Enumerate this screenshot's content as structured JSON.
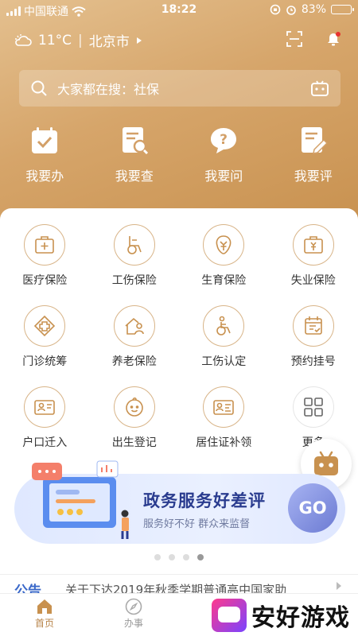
{
  "status_bar": {
    "carrier": "中国联通",
    "time": "18:22",
    "battery": "83%",
    "battery_level": 0.83
  },
  "header": {
    "temperature": "11°C",
    "city": "北京市"
  },
  "search": {
    "placeholder": "大家都在搜：社保"
  },
  "quick_actions": [
    {
      "label": "我要办",
      "icon": "calendar-check-icon"
    },
    {
      "label": "我要查",
      "icon": "document-search-icon"
    },
    {
      "label": "我要问",
      "icon": "question-bubble-icon"
    },
    {
      "label": "我要评",
      "icon": "document-edit-icon"
    }
  ],
  "services": [
    {
      "label": "医疗保险",
      "icon": "medical-kit-icon"
    },
    {
      "label": "工伤保险",
      "icon": "wheelchair-icon"
    },
    {
      "label": "生育保险",
      "icon": "maternity-icon"
    },
    {
      "label": "失业保险",
      "icon": "yuan-briefcase-icon"
    },
    {
      "label": "门诊统筹",
      "icon": "clinic-cross-icon"
    },
    {
      "label": "养老保险",
      "icon": "elder-home-icon"
    },
    {
      "label": "工伤认定",
      "icon": "injury-wheelchair-icon"
    },
    {
      "label": "预约挂号",
      "icon": "appointment-calendar-icon"
    },
    {
      "label": "户口迁入",
      "icon": "id-card-icon"
    },
    {
      "label": "出生登记",
      "icon": "baby-face-icon"
    },
    {
      "label": "居住证补领",
      "icon": "residence-card-icon"
    },
    {
      "label": "更多",
      "icon": "grid-more-icon"
    }
  ],
  "banner": {
    "title": "政务服务好差评",
    "subtitle": "服务好不好   群众来监督",
    "go_label": "GO"
  },
  "carousel": {
    "count": 4,
    "active_index": 3
  },
  "notice": {
    "tag": "公告",
    "text": "关于下达2019年秋季学期普通高中国家助"
  },
  "tabbar": [
    {
      "label": "首页"
    },
    {
      "label": "办事"
    }
  ],
  "watermark": {
    "text": "安好游戏"
  },
  "colors": {
    "accent": "#c8914f",
    "banner_title": "#2a3c8f",
    "notice_tag": "#3a68c9"
  }
}
